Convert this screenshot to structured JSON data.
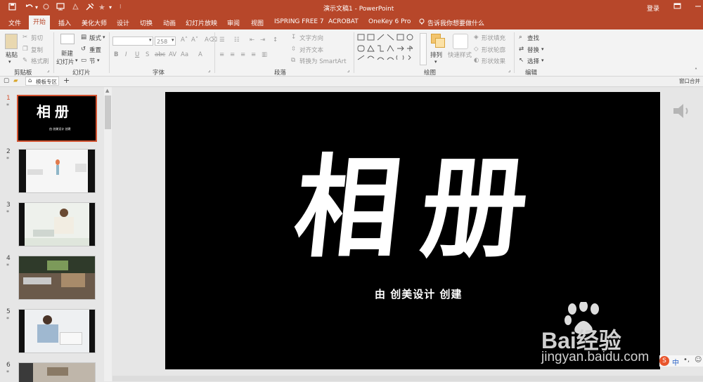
{
  "titlebar": {
    "doc_title": "演示文稿1 - PowerPoint",
    "login": "登录"
  },
  "tabs": [
    {
      "label": "文件"
    },
    {
      "label": "开始"
    },
    {
      "label": "插入"
    },
    {
      "label": "美化大师"
    },
    {
      "label": "设计"
    },
    {
      "label": "切换"
    },
    {
      "label": "动画"
    },
    {
      "label": "幻灯片放映"
    },
    {
      "label": "审阅"
    },
    {
      "label": "视图"
    },
    {
      "label": "ISPRING FREE 7"
    },
    {
      "label": "ACROBAT"
    },
    {
      "label": "OneKey 6 Pro"
    },
    {
      "label": "告诉我你想要做什么"
    }
  ],
  "ribbon": {
    "clipboard": {
      "paste": "粘贴",
      "cut": "剪切",
      "copy": "复制",
      "format_painter": "格式刷",
      "group": "剪贴板"
    },
    "slides": {
      "new_slide_1": "新建",
      "new_slide_2": "幻灯片",
      "layout": "版式",
      "reset": "重置",
      "section": "节",
      "group": "幻灯片"
    },
    "font": {
      "size": "258",
      "group": "字体"
    },
    "paragraph": {
      "text_direction": "文字方向",
      "align_text": "对齐文本",
      "to_smartart": "转换为 SmartArt",
      "group": "段落"
    },
    "drawing": {
      "arrange": "排列",
      "quick_styles": "快速样式",
      "shape_fill": "形状填充",
      "shape_outline": "形状轮廓",
      "shape_effects": "形状效果",
      "group": "绘图"
    },
    "editing": {
      "find": "查找",
      "replace": "替换",
      "select": "选择",
      "group": "编辑"
    }
  },
  "subbar": {
    "template_zone": "模板专区",
    "window_merge": "窗口合并"
  },
  "slides": [
    {
      "num": "1",
      "star": "*"
    },
    {
      "num": "2",
      "star": "*"
    },
    {
      "num": "3",
      "star": "*"
    },
    {
      "num": "4",
      "star": "*"
    },
    {
      "num": "5",
      "star": "*"
    },
    {
      "num": "6",
      "star": "*"
    }
  ],
  "slide": {
    "title": "相册",
    "subtitle": "由 创美设计 创建",
    "thumb_subtitle": "由 创美设计 创建"
  },
  "watermark": {
    "brand": "Bai经验",
    "url": "jingyan.baidu.com",
    "ime": "中"
  },
  "colors": {
    "accent": "#b7472a",
    "active_border": "#d35230"
  }
}
